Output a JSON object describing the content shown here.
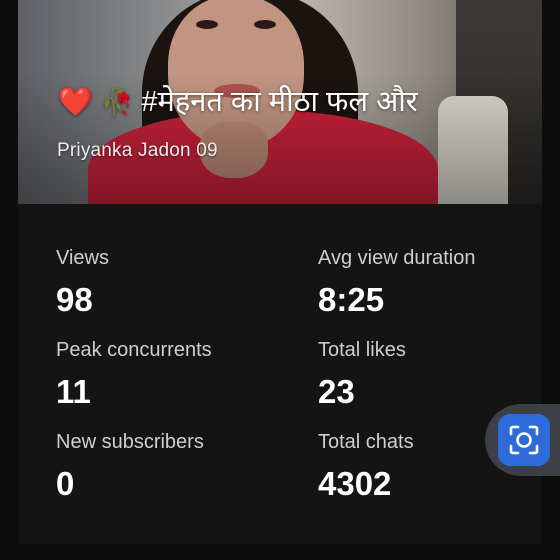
{
  "video": {
    "title_emoji_heart": "❤️",
    "title_emoji_rose": "🥀",
    "title_text": "#मेहनत का मीठा फल और",
    "channel": "Priyanka Jadon 09"
  },
  "stats": [
    {
      "label": "Views",
      "value": "98"
    },
    {
      "label": "Avg view duration",
      "value": "8:25"
    },
    {
      "label": "Peak concurrents",
      "value": "11"
    },
    {
      "label": "Total likes",
      "value": "23"
    },
    {
      "label": "New subscribers",
      "value": "0"
    },
    {
      "label": "Total chats",
      "value": "4302"
    }
  ],
  "colors": {
    "background": "#0d0d0d",
    "card": "#141414",
    "label": "#cfcfcf",
    "value": "#ffffff",
    "fab_button": "#2f6bd8"
  },
  "icons": {
    "fab": "screenshot-capture-icon"
  }
}
